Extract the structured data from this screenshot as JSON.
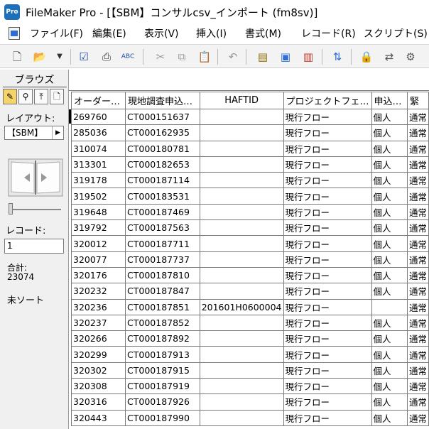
{
  "window": {
    "app_icon_text": "Pro",
    "title": "FileMaker Pro - [【SBM】コンサルcsv_インポート (fm8sv)]"
  },
  "menubar": {
    "items": [
      "ファイル(F)",
      "編集(E)",
      "表示(V)",
      "挿入(I)",
      "書式(M)",
      "レコード(R)",
      "スクリプト(S)"
    ]
  },
  "toolbar": {
    "icons": [
      "new-document-icon",
      "open-folder-icon",
      "dropdown-arrow-icon",
      "checkbox-icon",
      "print-icon",
      "spellcheck-icon",
      "cut-icon",
      "copy-icon",
      "paste-icon",
      "undo-icon",
      "new-record-icon",
      "duplicate-record-icon",
      "delete-record-icon",
      "sort-icon",
      "lock-icon",
      "relationship-icon",
      "script-icon"
    ]
  },
  "status_area": {
    "mode": "ブラウズ",
    "layout_label": "レイアウト:",
    "layout_value": "【SBM】",
    "record_label": "レコード:",
    "record_value": "1",
    "total_label": "合計:",
    "total_value": "23074",
    "sort_status": "未ソート"
  },
  "table": {
    "columns": [
      "オーダー…",
      "現地調査申込…",
      "HAFTID",
      "プロジェクトフェ…",
      "申込…",
      "緊"
    ],
    "rows": [
      [
        "269760",
        "CT000151637",
        "",
        "現行フロー",
        "個人",
        "通常"
      ],
      [
        "285036",
        "CT000162935",
        "",
        "現行フロー",
        "個人",
        "通常"
      ],
      [
        "310074",
        "CT000180781",
        "",
        "現行フロー",
        "個人",
        "通常"
      ],
      [
        "313301",
        "CT000182653",
        "",
        "現行フロー",
        "個人",
        "通常"
      ],
      [
        "319178",
        "CT000187114",
        "",
        "現行フロー",
        "個人",
        "通常"
      ],
      [
        "319502",
        "CT000183531",
        "",
        "現行フロー",
        "個人",
        "通常"
      ],
      [
        "319648",
        "CT000187469",
        "",
        "現行フロー",
        "個人",
        "通常"
      ],
      [
        "319792",
        "CT000187563",
        "",
        "現行フロー",
        "個人",
        "通常"
      ],
      [
        "320012",
        "CT000187711",
        "",
        "現行フロー",
        "個人",
        "通常"
      ],
      [
        "320077",
        "CT000187737",
        "",
        "現行フロー",
        "個人",
        "通常"
      ],
      [
        "320176",
        "CT000187810",
        "",
        "現行フロー",
        "個人",
        "通常"
      ],
      [
        "320232",
        "CT000187847",
        "",
        "現行フロー",
        "個人",
        "通常"
      ],
      [
        "320236",
        "CT000187851",
        "201601H0600004",
        "現行フロー",
        "",
        "通常"
      ],
      [
        "320237",
        "CT000187852",
        "",
        "現行フロー",
        "個人",
        "通常"
      ],
      [
        "320266",
        "CT000187892",
        "",
        "現行フロー",
        "個人",
        "通常"
      ],
      [
        "320299",
        "CT000187913",
        "",
        "現行フロー",
        "個人",
        "通常"
      ],
      [
        "320302",
        "CT000187915",
        "",
        "現行フロー",
        "個人",
        "通常"
      ],
      [
        "320308",
        "CT000187919",
        "",
        "現行フロー",
        "個人",
        "通常"
      ],
      [
        "320316",
        "CT000187926",
        "",
        "現行フロー",
        "個人",
        "通常"
      ],
      [
        "320443",
        "CT000187990",
        "",
        "現行フロー",
        "個人",
        "通常"
      ]
    ]
  }
}
